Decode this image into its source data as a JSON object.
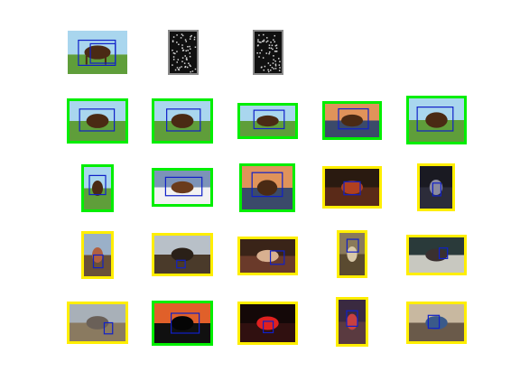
{
  "colors": {
    "match_border": "#00ee00",
    "nonmatch_border": "#ffee00",
    "detection_box": "#1020c8",
    "feature_bg": "#101010",
    "feature_frame": "#8a8a8a"
  },
  "query_row": [
    {
      "kind": "query-image",
      "scene": "horse-field"
    },
    {
      "kind": "feature-map"
    },
    {
      "kind": "feature-map"
    }
  ],
  "results": [
    {
      "rank": 1,
      "match": true,
      "scene": "horse-field"
    },
    {
      "rank": 2,
      "match": true,
      "scene": "horse-field"
    },
    {
      "rank": 3,
      "match": true,
      "scene": "horse-field"
    },
    {
      "rank": 4,
      "match": true,
      "scene": "horse-sunset"
    },
    {
      "rank": 5,
      "match": true,
      "scene": "horse-field"
    },
    {
      "rank": 6,
      "match": true,
      "scene": "horse-field"
    },
    {
      "rank": 7,
      "match": true,
      "scene": "horse-snow"
    },
    {
      "rank": 8,
      "match": true,
      "scene": "horse-sunset"
    },
    {
      "rank": 9,
      "match": false,
      "scene": "indoor-dark"
    },
    {
      "rank": 10,
      "match": false,
      "scene": "street-night"
    },
    {
      "rank": 11,
      "match": false,
      "scene": "outdoor-people"
    },
    {
      "rank": 12,
      "match": false,
      "scene": "field-ground"
    },
    {
      "rank": 13,
      "match": false,
      "scene": "people-indoor"
    },
    {
      "rank": 14,
      "match": false,
      "scene": "dog-outdoor"
    },
    {
      "rank": 15,
      "match": false,
      "scene": "shop-interior"
    },
    {
      "rank": 16,
      "match": false,
      "scene": "crowd-animals"
    },
    {
      "rank": 17,
      "match": true,
      "scene": "horse-silhouette-sunset"
    },
    {
      "rank": 18,
      "match": false,
      "scene": "night-lights"
    },
    {
      "rank": 19,
      "match": false,
      "scene": "building-night"
    },
    {
      "rank": 20,
      "match": false,
      "scene": "classroom"
    }
  ]
}
